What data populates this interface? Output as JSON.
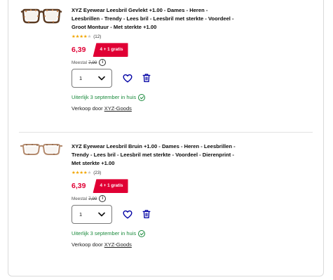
{
  "products": [
    {
      "title_lines": [
        "XYZ Eyewear Leesbril Gevlekt +1.00 - Dames - Heren -",
        "Leesbrillen - Trendy - Lees bril - Leesbril met sterkte - Voordeel -",
        "Groot Montuur - Met sterkte +1.00"
      ],
      "rating": 4,
      "rating_max": 5,
      "review_count": "(12)",
      "price": "6,39",
      "promo_badge": "4 + 1 gratis",
      "old_price_label": "Meestal",
      "old_price": "7,99",
      "info_icon_glyph": "i",
      "quantity": "1",
      "delivery_text": "Uiterlijk 3 september in huis",
      "seller_prefix": "Verkoop door",
      "seller_name": "XYZ-Goods",
      "frame_style": "tortoise"
    },
    {
      "title_lines": [
        "XYZ Eyewear Leesbril Bruin +1.00 - Dames - Heren - Leesbrillen -",
        "Trendy - Lees bril - Leesbril met sterkte - Voordeel - Dierenprint -",
        "Met sterkte +1.00"
      ],
      "rating": 4,
      "rating_max": 5,
      "review_count": "(23)",
      "price": "6,39",
      "promo_badge": "4 + 1 gratis",
      "old_price_label": "Meestal",
      "old_price": "7,99",
      "info_icon_glyph": "i",
      "quantity": "1",
      "delivery_text": "Uiterlijk 3 september in huis",
      "seller_prefix": "Verkoop door",
      "seller_name": "XYZ-Goods",
      "frame_style": "brown"
    }
  ],
  "icons": {
    "favorite": "heart-icon",
    "delete": "trash-icon",
    "quantity_toggle": "chevron-down-icon",
    "delivery": "check-circle-icon"
  },
  "colors": {
    "price": "#e00034",
    "promo_bg": "#e00034",
    "link_blue": "#0000a4",
    "delivery_green": "#1a8a3c",
    "star": "#f2a600"
  }
}
